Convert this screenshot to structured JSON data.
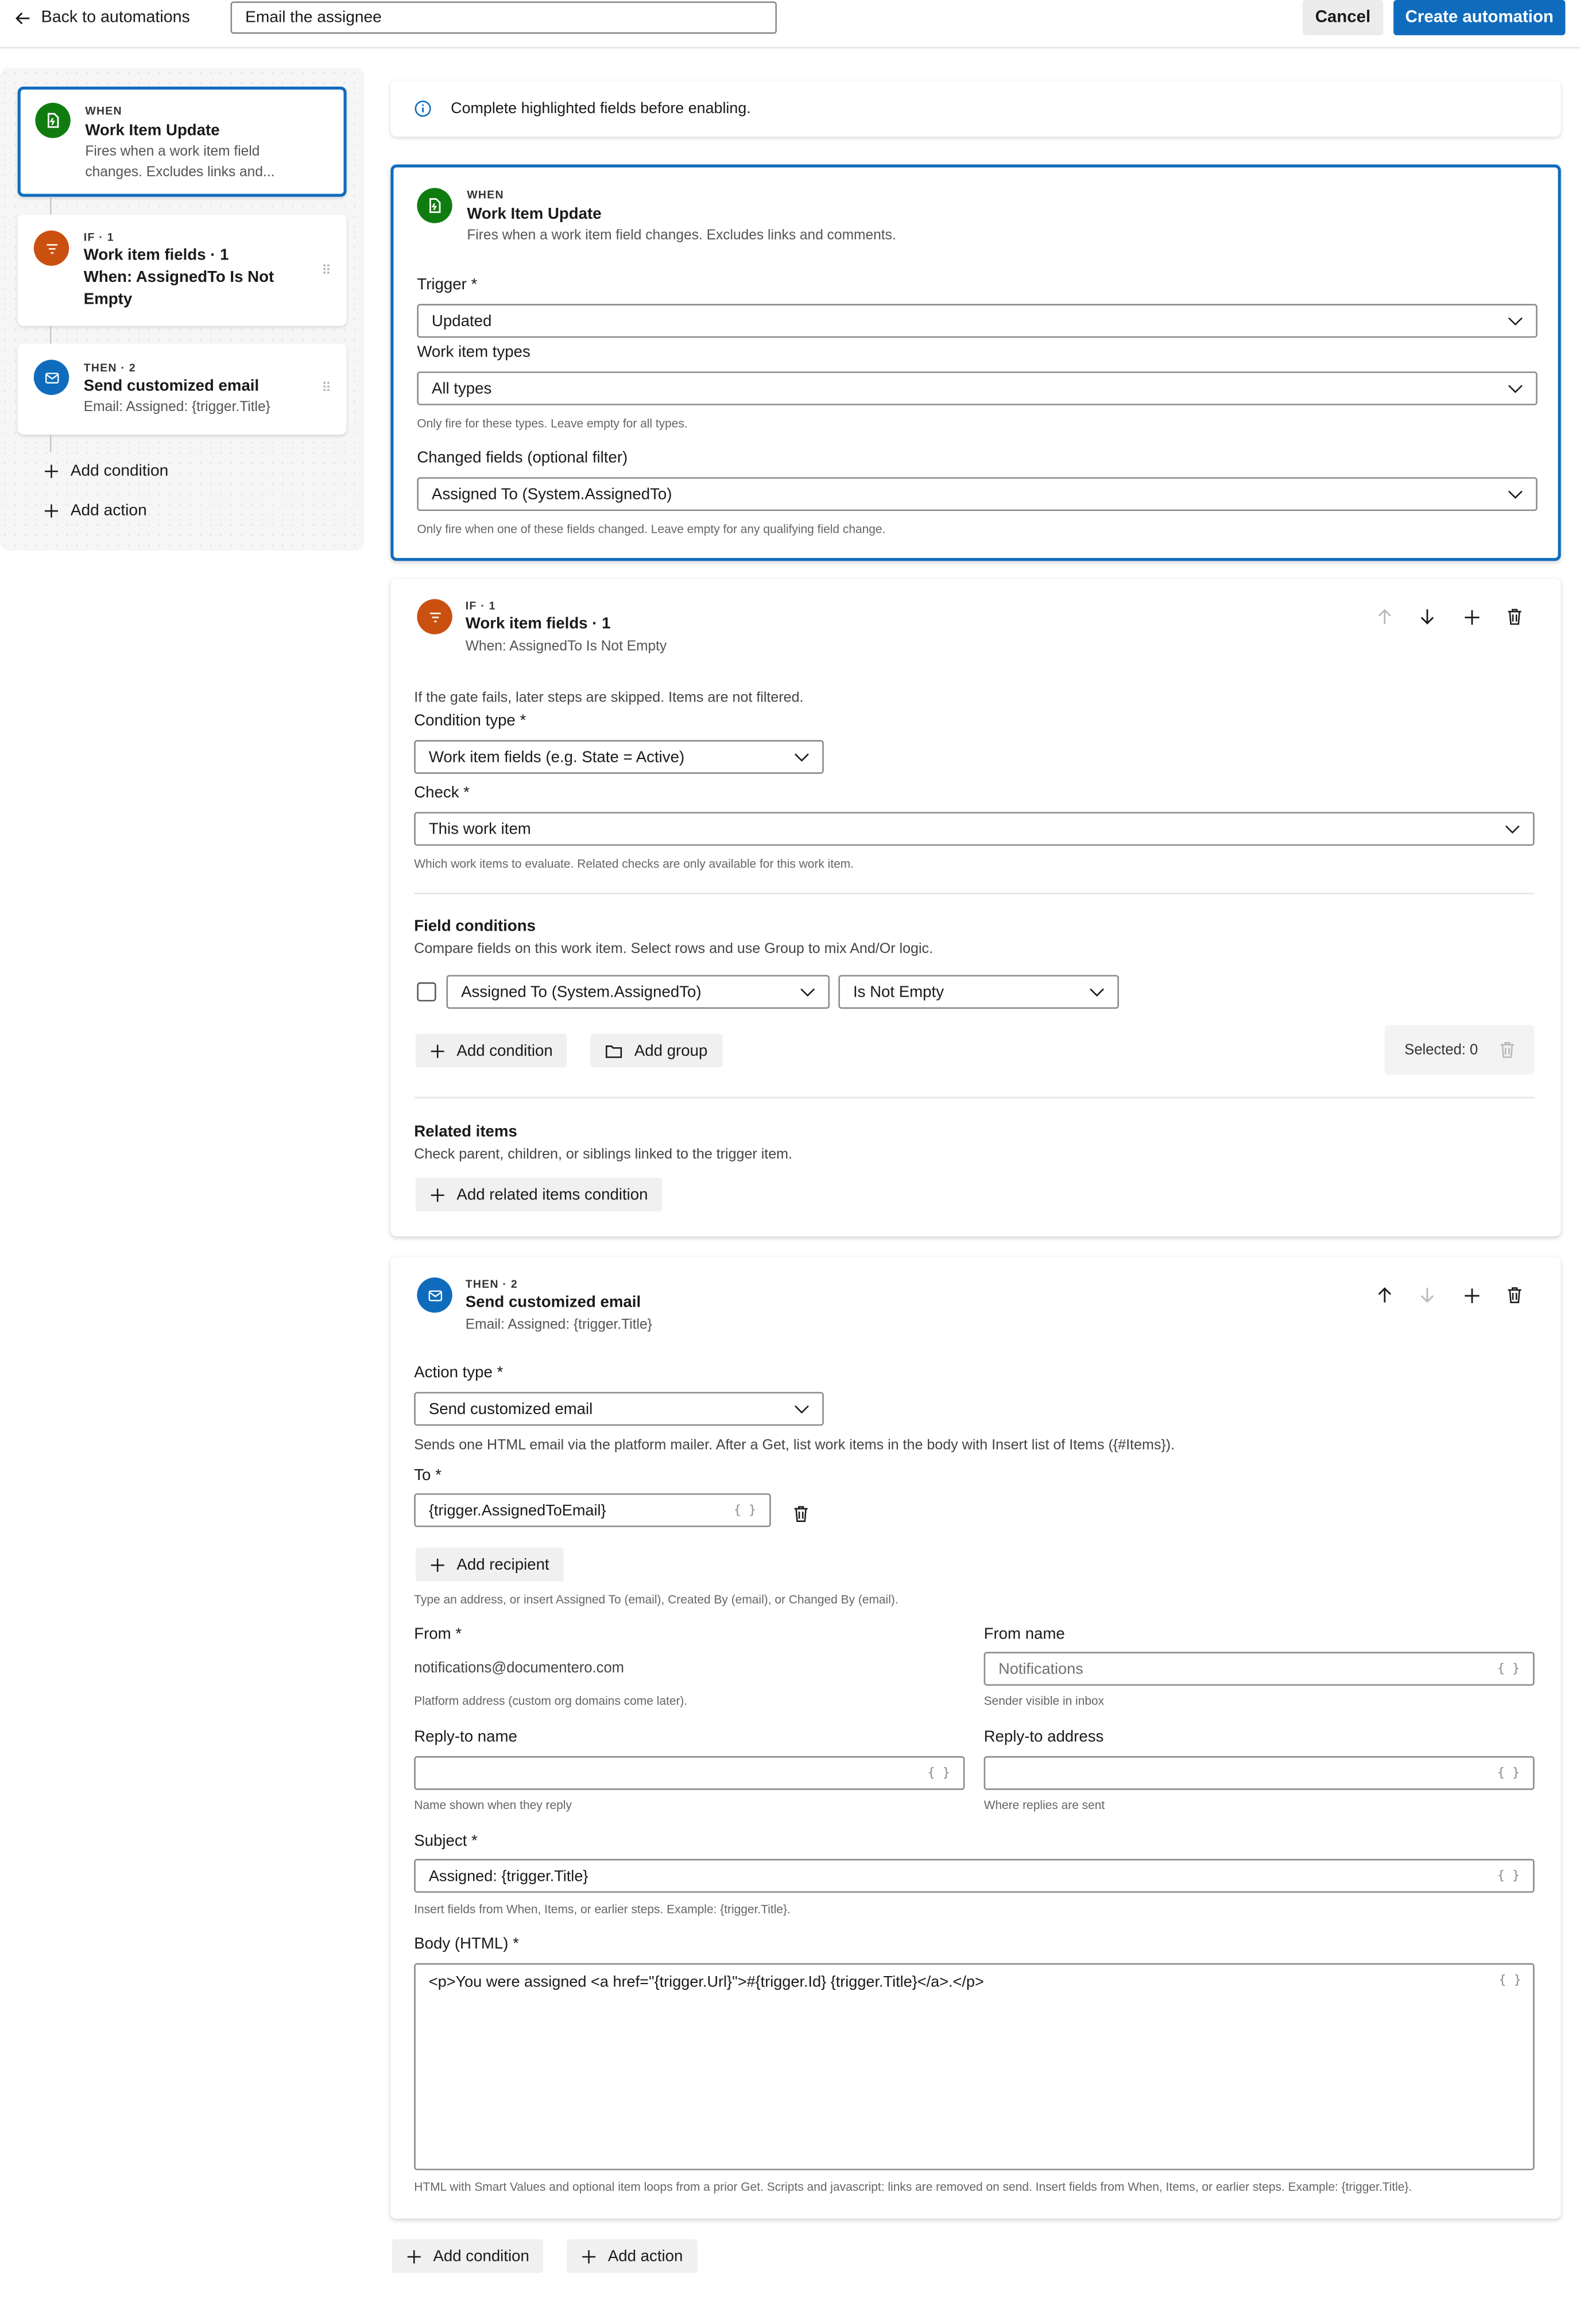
{
  "header": {
    "back_label": "Back to automations",
    "automation_name": "Email the assignee",
    "cancel_label": "Cancel",
    "create_label": "Create automation"
  },
  "sidebar": {
    "when": {
      "eyebrow": "WHEN",
      "title": "Work Item Update",
      "subtitle": "Fires when a work item field changes. Excludes links and..."
    },
    "if": {
      "eyebrow": "IF · 1",
      "title": "Work item fields · 1",
      "title2": "When: AssignedTo Is Not Empty"
    },
    "then": {
      "eyebrow": "THEN · 2",
      "title": "Send customized email",
      "subtitle": "Email: Assigned: {trigger.Title}"
    },
    "add_condition": "Add condition",
    "add_action": "Add action"
  },
  "info": {
    "message": "Complete highlighted fields before enabling."
  },
  "when_card": {
    "eyebrow": "WHEN",
    "title": "Work Item Update",
    "subtitle": "Fires when a work item field changes. Excludes links and comments.",
    "trigger_label": "Trigger *",
    "trigger_value": "Updated",
    "types_label": "Work item types",
    "types_value": "All types",
    "types_hint": "Only fire for these types. Leave empty for all types.",
    "changed_label": "Changed fields (optional filter)",
    "changed_value": "Assigned To (System.AssignedTo)",
    "changed_hint": "Only fire when one of these fields changed. Leave empty for any qualifying field change."
  },
  "if_card": {
    "eyebrow": "IF · 1",
    "title": "Work item fields · 1",
    "subtitle": "When: AssignedTo Is Not Empty",
    "gate_note": "If the gate fails, later steps are skipped. Items are not filtered.",
    "condition_type_label": "Condition type *",
    "condition_type_value": "Work item fields (e.g. State = Active)",
    "check_label": "Check *",
    "check_value": "This work item",
    "check_hint": "Which work items to evaluate. Related checks are only available for this work item.",
    "field_conditions_title": "Field conditions",
    "field_conditions_desc": "Compare fields on this work item. Select rows and use Group to mix And/Or logic.",
    "cond_field": "Assigned To (System.AssignedTo)",
    "cond_operator": "Is Not Empty",
    "add_condition": "Add condition",
    "add_group": "Add group",
    "selected_label": "Selected: 0",
    "related_title": "Related items",
    "related_desc": "Check parent, children, or siblings linked to the trigger item.",
    "add_related": "Add related items condition"
  },
  "then_card": {
    "eyebrow": "THEN · 2",
    "title": "Send customized email",
    "subtitle": "Email: Assigned: {trigger.Title}",
    "action_type_label": "Action type *",
    "action_type_value": "Send customized email",
    "action_note": "Sends one HTML email via the platform mailer. After a Get, list work items in the body with Insert list of Items ({#Items}).",
    "to_label": "To *",
    "to_value": "{trigger.AssignedToEmail}",
    "add_recipient": "Add recipient",
    "to_hint": "Type an address, or insert Assigned To (email), Created By (email), or Changed By (email).",
    "from_label": "From *",
    "from_value": "notifications@documentero.com",
    "from_hint": "Platform address (custom org domains come later).",
    "from_name_label": "From name",
    "from_name_placeholder": "Notifications",
    "from_name_hint": "Sender visible in inbox",
    "reply_name_label": "Reply-to name",
    "reply_name_hint": "Name shown when they reply",
    "reply_address_label": "Reply-to address",
    "reply_address_hint": "Where replies are sent",
    "subject_label": "Subject *",
    "subject_value": "Assigned: {trigger.Title}",
    "subject_hint": "Insert fields from When, Items, or earlier steps. Example: {trigger.Title}.",
    "body_label": "Body (HTML) *",
    "body_value": "<p>You were assigned <a href=\"{trigger.Url}\">#{trigger.Id} {trigger.Title}</a>.</p>",
    "body_hint": "HTML with Smart Values and optional item loops from a prior Get. Scripts and javascript: links are removed on send. Insert fields from When, Items, or earlier steps. Example: {trigger.Title}.",
    "brace_glyph": "{ }"
  },
  "footer": {
    "add_condition": "Add condition",
    "add_action": "Add action"
  },
  "colors": {
    "accent": "#0f6cbd",
    "when": "#107c10",
    "if": "#ca5010",
    "then": "#0f6cbd"
  },
  "icons": [
    "arrow-left-icon",
    "info-icon",
    "trigger-icon",
    "filter-icon",
    "mail-icon",
    "chevron-down-icon",
    "arrow-up-icon",
    "arrow-down-icon",
    "plus-icon",
    "trash-icon",
    "folder-icon",
    "braces-icon",
    "drag-handle-icon"
  ]
}
